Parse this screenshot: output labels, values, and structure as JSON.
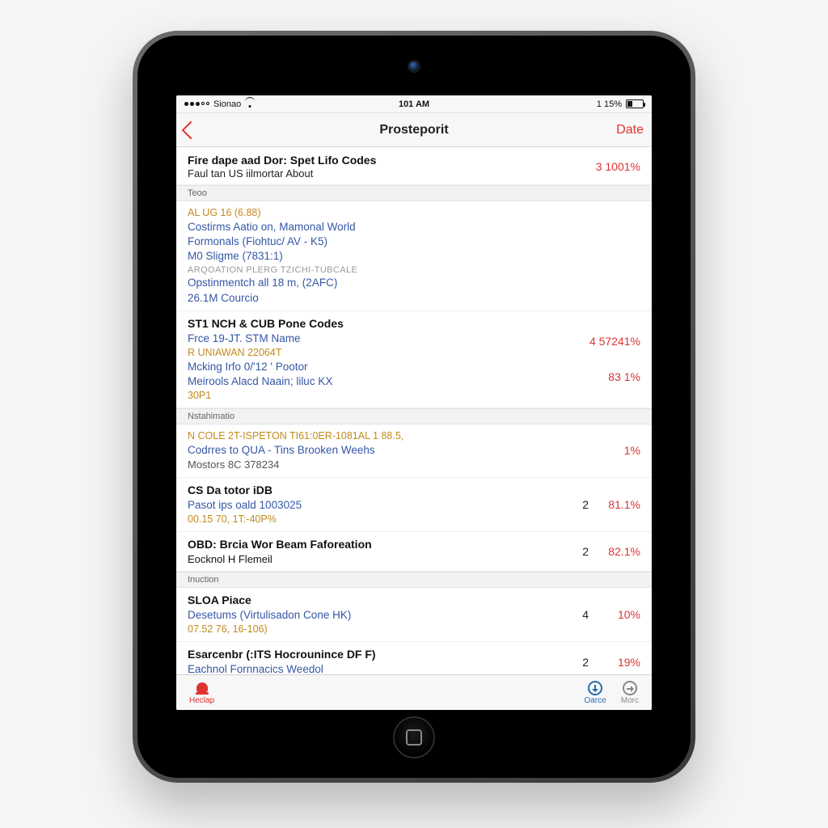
{
  "status": {
    "carrier": "Sionao",
    "time": "101 AM",
    "battery": "1 15%"
  },
  "nav": {
    "title": "Prosteporit",
    "right": "Date"
  },
  "lead": {
    "l1": "Fire dape aad Dor: Spet Lifo Codes",
    "l2": "Faul tan US iilmortar About",
    "pct": "3 1001%"
  },
  "sec1": {
    "header": "Teoo",
    "lines": [
      {
        "cls": "meta-amber",
        "t": "AL UG 16 (6.88)"
      },
      {
        "cls": "link-blue",
        "t": "Costirms Aatio on, Mamonal World"
      },
      {
        "cls": "link-blue",
        "t": "Formonals (Fiohtuc/ AV - K5)"
      },
      {
        "cls": "link-blue",
        "t": "M0 Sligme (7831:1)"
      },
      {
        "cls": "muted-caps",
        "t": "ARQOATION PLERG  TZICHI-TUBCALE"
      },
      {
        "cls": "link-blue",
        "t": "Opstinmentch all 18 m, (2AFC)"
      },
      {
        "cls": "link-blue",
        "t": "26.1M Courcio"
      }
    ]
  },
  "sec2": {
    "title": "ST1 NCH & CUB Pone Codes",
    "sub": "Frce 19-JT. STM Name",
    "pcts": [
      "4 57241%",
      "83 1%"
    ],
    "lines": [
      {
        "cls": "meta-amber",
        "t": "R UNIAWAN  22064T"
      },
      {
        "cls": "link-blue",
        "t": "Mcking Irfo 0/'12 ' Pootor"
      },
      {
        "cls": "link-blue",
        "t": "Meirools Alacd Naain; liluc KX"
      },
      {
        "cls": "meta-amber",
        "t": "30P1"
      }
    ]
  },
  "sec3": {
    "header": "Nstahimatio",
    "pct": "1%",
    "lines": [
      {
        "cls": "meta-amber",
        "t": "N COLE 2T-ISPETON TI61:0ER-1081AL 1 88.5,"
      },
      {
        "cls": "link-blue",
        "t": "Codrres to QUA - Tins Brooken Weehs"
      },
      {
        "cls": "muted",
        "t": "Mostors 8C 378234"
      }
    ]
  },
  "sec4": {
    "title": "CS Da totor iDB",
    "num": "2",
    "pct": "81.1%",
    "lines": [
      {
        "cls": "link-blue",
        "t": "Pasot ips oald 1003025"
      },
      {
        "cls": "meta-amber",
        "t": "00.15 70, 1T:-40P%"
      }
    ]
  },
  "sec5": {
    "title": "OBD: Brcia Wor Beam Faforeation",
    "sub": "Eocknol H Flemeil",
    "num": "2",
    "pct": "82.1%"
  },
  "sec6": {
    "header": "Inuction"
  },
  "sec7": {
    "title": "SLOA Piace",
    "num": "4",
    "pct": "10%",
    "lines": [
      {
        "cls": "link-blue",
        "t": "Desetums (Virtulisadon Cone HK)"
      },
      {
        "cls": "meta-amber",
        "t": "07.52 76, 16-106)"
      }
    ]
  },
  "sec8": {
    "title": "Esarcenbr (:ITS Hocrounince DF F)",
    "sub_blue": "Eachnol Fornnacics Weedol",
    "num": "2",
    "pct": "19%"
  },
  "tabs": {
    "left": "Heclap",
    "mid": "Oarce",
    "right": "Morc"
  }
}
